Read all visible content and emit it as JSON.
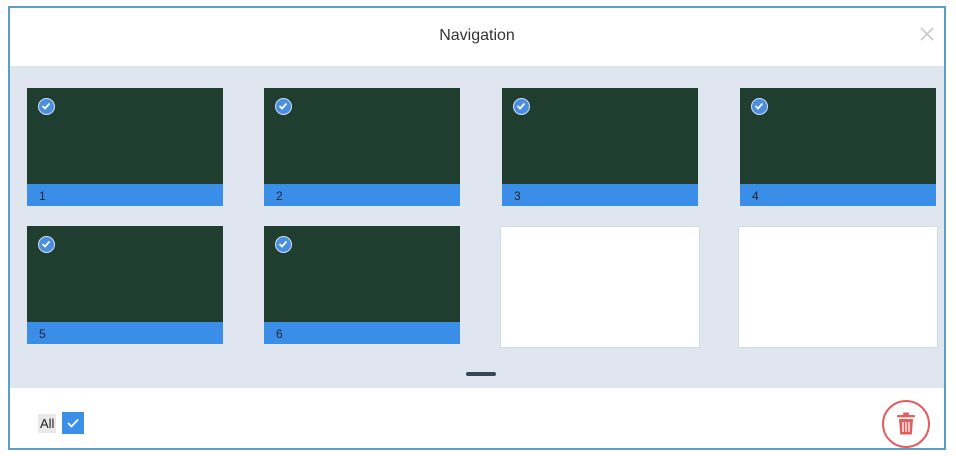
{
  "dialog": {
    "title": "Navigation",
    "close_icon": "close-icon"
  },
  "pages": [
    {
      "label": "1",
      "selected": true,
      "filled": true
    },
    {
      "label": "2",
      "selected": true,
      "filled": true
    },
    {
      "label": "3",
      "selected": true,
      "filled": true
    },
    {
      "label": "4",
      "selected": true,
      "filled": true
    },
    {
      "label": "5",
      "selected": true,
      "filled": true
    },
    {
      "label": "6",
      "selected": true,
      "filled": true
    },
    {
      "label": "",
      "selected": false,
      "filled": false
    },
    {
      "label": "",
      "selected": false,
      "filled": false
    }
  ],
  "footer": {
    "all_label": "All",
    "all_checked": true,
    "delete_icon": "trash-icon"
  },
  "colors": {
    "accent": "#3b8ee8",
    "thumb_fill": "#203e2f",
    "delete": "#e45d5d",
    "grid_bg": "#dfe6ef"
  }
}
